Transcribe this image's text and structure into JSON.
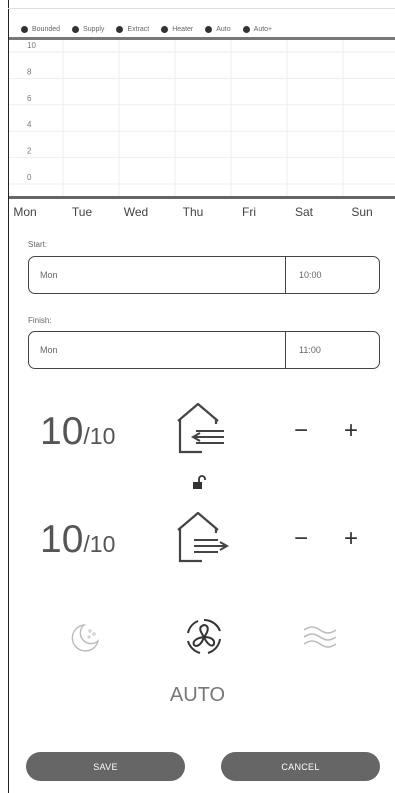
{
  "legend": {
    "items": [
      {
        "label": "Bounded"
      },
      {
        "label": "Supply"
      },
      {
        "label": "Extract"
      },
      {
        "label": "Heater"
      },
      {
        "label": "Auto"
      },
      {
        "label": "Auto+"
      }
    ]
  },
  "chart_data": {
    "type": "bar",
    "categories": [
      "Mon",
      "Tue",
      "Wed",
      "Thu",
      "Fri",
      "Sat",
      "Sun"
    ],
    "series": [],
    "ylim": [
      0,
      10
    ],
    "yticks": [
      "0",
      "2",
      "4",
      "6",
      "8",
      "10"
    ],
    "grid": true,
    "legend_placement": "top"
  },
  "schedule": {
    "start_label": "Start:",
    "start_day": "Mon",
    "start_time": "10:00",
    "finish_label": "Finish:",
    "finish_day": "Mon",
    "finish_time": "11:00"
  },
  "supply": {
    "level": "10",
    "max": "/10",
    "minus": "−",
    "plus": "+"
  },
  "extract": {
    "level": "10",
    "max": "/10",
    "minus": "−",
    "plus": "+"
  },
  "mode": {
    "label": "AUTO"
  },
  "actions": {
    "save": "SAVE",
    "cancel": "CANCEL"
  },
  "colors": {
    "accent": "#666666",
    "icon": "#444444",
    "muted_icon": "#bbbbbb"
  }
}
